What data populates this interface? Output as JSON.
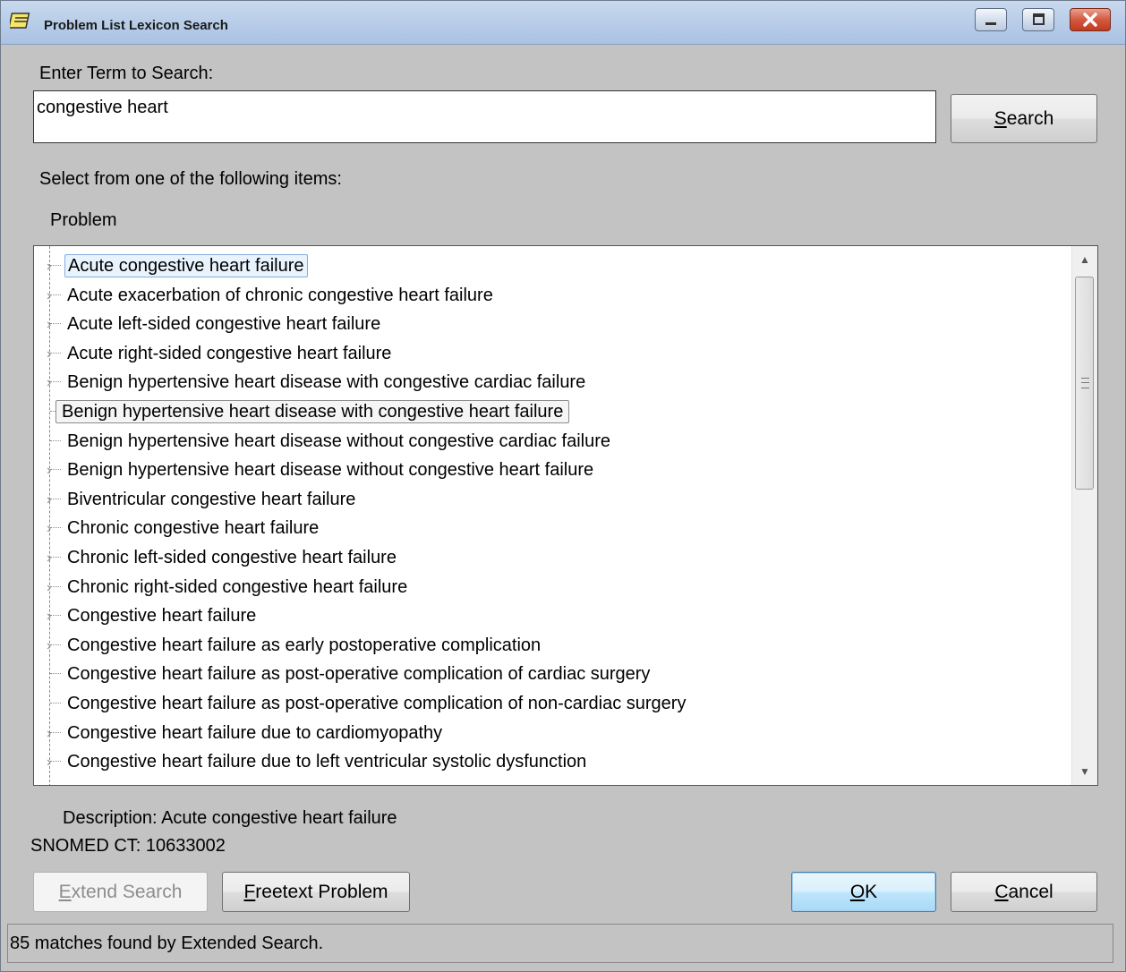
{
  "window": {
    "title": "Problem List  Lexicon Search"
  },
  "search": {
    "prompt_label": "Enter Term to Search:",
    "value": "congestive heart",
    "button_prefix": "",
    "button_mnemonic": "S",
    "button_rest": "earch"
  },
  "list": {
    "instruction": "Select from one of the following items:",
    "column_header": "Problem",
    "items": [
      {
        "label": "Acute congestive heart failure",
        "expandable": true,
        "state": "selected"
      },
      {
        "label": "Acute exacerbation of chronic congestive heart failure",
        "expandable": true,
        "state": ""
      },
      {
        "label": "Acute left-sided congestive heart failure",
        "expandable": true,
        "state": ""
      },
      {
        "label": "Acute right-sided congestive heart failure",
        "expandable": true,
        "state": ""
      },
      {
        "label": "Benign hypertensive heart disease with congestive cardiac failure",
        "expandable": true,
        "state": ""
      },
      {
        "label": "Benign hypertensive heart disease with congestive heart failure",
        "expandable": false,
        "state": "hot"
      },
      {
        "label": "Benign hypertensive heart disease without congestive cardiac failure",
        "expandable": false,
        "state": ""
      },
      {
        "label": "Benign hypertensive heart disease without congestive heart failure",
        "expandable": true,
        "state": ""
      },
      {
        "label": "Biventricular congestive heart failure",
        "expandable": true,
        "state": ""
      },
      {
        "label": "Chronic congestive heart failure",
        "expandable": true,
        "state": ""
      },
      {
        "label": "Chronic left-sided congestive heart failure",
        "expandable": true,
        "state": ""
      },
      {
        "label": "Chronic right-sided congestive heart failure",
        "expandable": true,
        "state": ""
      },
      {
        "label": "Congestive heart failure",
        "expandable": true,
        "state": ""
      },
      {
        "label": "Congestive heart failure as early postoperative complication",
        "expandable": true,
        "state": ""
      },
      {
        "label": "Congestive heart failure as post-operative complication of cardiac surgery",
        "expandable": false,
        "state": ""
      },
      {
        "label": "Congestive heart failure as post-operative complication of non-cardiac surgery",
        "expandable": false,
        "state": ""
      },
      {
        "label": "Congestive heart failure due to cardiomyopathy",
        "expandable": true,
        "state": ""
      },
      {
        "label": "Congestive heart failure due to left ventricular systolic dysfunction",
        "expandable": true,
        "state": ""
      }
    ]
  },
  "details": {
    "description_label": "Description:",
    "description_value": "Acute congestive heart failure",
    "code_label": "SNOMED CT:",
    "code_value": "10633002"
  },
  "buttons": {
    "extend_mnemonic": "E",
    "extend_rest": "xtend Search",
    "freetext_mnemonic": "F",
    "freetext_rest": "reetext Problem",
    "ok_mnemonic": "O",
    "ok_rest": "K",
    "cancel_mnemonic": "C",
    "cancel_rest": "ancel"
  },
  "status": {
    "text": "85 matches found by Extended Search."
  },
  "colors": {
    "selection_fill": "#e8f3fd",
    "selection_border": "#84acdd",
    "close_button": "#c23a20"
  }
}
